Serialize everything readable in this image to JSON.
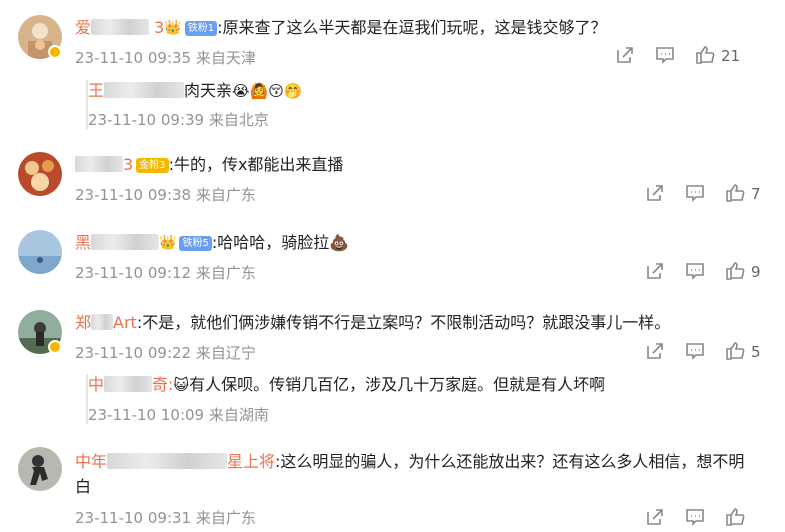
{
  "comments": [
    {
      "name_prefix": "爱",
      "name_suffix": "3",
      "fan_badge": "铁粉1",
      "text": ":原来查了这么半天都是在逗我们玩呢，这是钱交够了？",
      "meta": "23-11-10 09:35 来自天津",
      "likes": "21",
      "reply": {
        "name_prefix": "王",
        "text": "肉天亲",
        "emojis": "😭🙆😚🤭",
        "meta": "23-11-10 09:39 来自北京"
      }
    },
    {
      "name_prefix": "",
      "name_suffix": "3",
      "fan_badge": "金粉3",
      "text": ":牛的，传x都能出来直播",
      "meta": "23-11-10 09:38 来自广东",
      "likes": "7"
    },
    {
      "name_prefix": "黑",
      "fan_badge": "铁粉5",
      "text": ":哈哈哈，骑脸拉💩",
      "meta": "23-11-10 09:12 来自广东",
      "likes": "9"
    },
    {
      "name_prefix": "郑",
      "name_suffix": "Art",
      "text": ":不是，就他们俩涉嫌传销不行是立案吗？不限制活动吗？就跟没事儿一样。",
      "meta": "23-11-10 09:22 来自辽宁",
      "likes": "5",
      "reply": {
        "name_prefix": "中",
        "name_suffix": "奇:",
        "emojis": "😺",
        "text": "有人保呗。传销几百亿，涉及几十万家庭。但就是有人坏啊",
        "meta": "23-11-10 10:09 来自湖南"
      }
    },
    {
      "name_prefix": "中年",
      "name_suffix": "星上将",
      "text": ":这么明显的骗人，为什么还能放出来？还有这么多人相信，想不明",
      "text2": "白",
      "meta": "23-11-10 09:31 来自广东"
    }
  ],
  "icons": {
    "share": "share-icon",
    "comment": "comment-icon",
    "like": "thumbs-up-icon",
    "verified": "verified-badge-icon"
  },
  "colors": {
    "username": "#eb7350",
    "meta": "#939393",
    "badge_blue": "#6a9ef5",
    "badge_gold": "#f5b800"
  }
}
